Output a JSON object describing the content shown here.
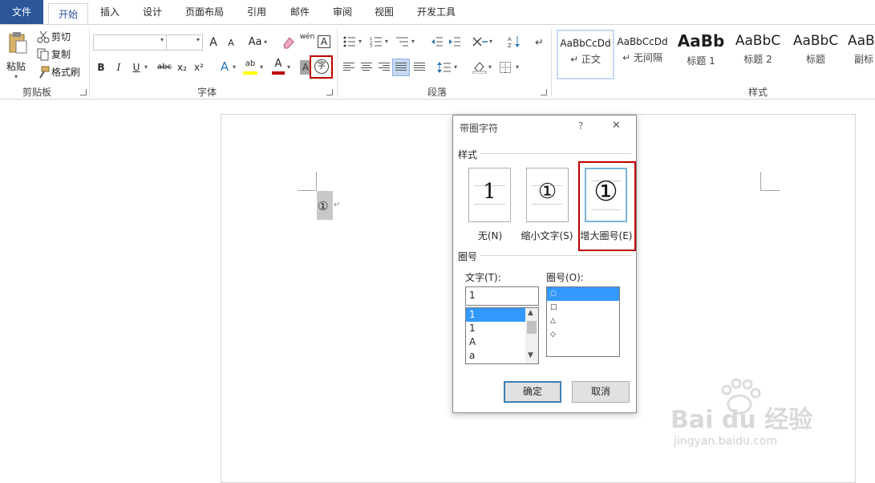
{
  "tabs": [
    "文件",
    "开始",
    "插入",
    "设计",
    "页面布局",
    "引用",
    "邮件",
    "审阅",
    "视图",
    "开发工具"
  ],
  "clipboard": {
    "paste_label": "粘贴",
    "cut_label": "剪切",
    "copy_label": "复制",
    "format_painter_label": "格式刷",
    "group_label": "剪贴板"
  },
  "font": {
    "font_name": "",
    "font_size": "",
    "grow_label": "A",
    "shrink_label": "A",
    "case_label": "Aa",
    "wen_label": "wén",
    "border_a_label": "A",
    "bold": "B",
    "italic": "I",
    "underline": "U",
    "strike": "abc",
    "subscript": "x₂",
    "superscript": "x²",
    "effects_label": "A",
    "highlight_label": "ab",
    "color_label": "A",
    "shade_label": "A",
    "enclose_char": "字",
    "group_label": "字体"
  },
  "paragraph": {
    "group_label": "段落"
  },
  "styles": {
    "items": [
      {
        "sample": "AaBbCcDd",
        "name": "↵ 正文"
      },
      {
        "sample": "AaBbCcDd",
        "name": "↵ 无间隔"
      },
      {
        "sample": "AaBb",
        "name": "标题 1"
      },
      {
        "sample": "AaBbC",
        "name": "标题 2"
      },
      {
        "sample": "AaBbC",
        "name": "标题"
      },
      {
        "sample": "AaBb",
        "name": "副标"
      }
    ],
    "group_label": "样式"
  },
  "document": {
    "enclosed_text": "①",
    "para_mark": "↵"
  },
  "dialog": {
    "title": "带圈字符",
    "help": "?",
    "close": "✕",
    "style_section": "样式",
    "options": [
      {
        "glyph": "1",
        "label": "无(N)"
      },
      {
        "glyph": "①",
        "label": "缩小文字(S)"
      },
      {
        "glyph": "①",
        "label": "增大圈号(E)"
      }
    ],
    "enclosure_section": "圈号",
    "text_label": "文字(T):",
    "text_value": "1",
    "text_list": [
      "1",
      "1",
      "A",
      "a"
    ],
    "circle_label": "圈号(O):",
    "circle_list": [
      "○",
      "□",
      "△",
      "◇"
    ],
    "ok": "确定",
    "cancel": "取消"
  },
  "watermark": {
    "brand": "Bai du 经验",
    "url": "jingyan.baidu.com"
  }
}
